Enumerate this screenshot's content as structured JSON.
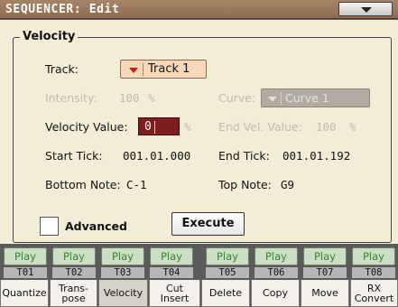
{
  "header": {
    "title": "SEQUENCER: Edit",
    "menu_icon": "chevron-down-icon"
  },
  "panel": {
    "section_title": "Velocity",
    "track": {
      "label": "Track:",
      "value": "Track 1"
    },
    "intensity": {
      "label": "Intensity:",
      "value": "100",
      "unit": "%"
    },
    "curve": {
      "label": "Curve:",
      "value": "Curve 1"
    },
    "velocity_value": {
      "label": "Velocity Value:",
      "value": "0",
      "unit": "%"
    },
    "end_vel_value": {
      "label": "End Vel. Value:",
      "value": "100",
      "unit": "%"
    },
    "start_tick": {
      "label": "Start Tick:",
      "value": "001.01.000"
    },
    "end_tick": {
      "label": "End Tick:",
      "value": "001.01.192"
    },
    "bottom_note": {
      "label": "Bottom Note:",
      "value": "C-1"
    },
    "top_note": {
      "label": "Top Note:",
      "value": "G9"
    },
    "advanced": {
      "label": "Advanced",
      "checked": false
    },
    "execute_label": "Execute"
  },
  "tracks": [
    {
      "play": "Play",
      "num": "T01"
    },
    {
      "play": "Play",
      "num": "T02"
    },
    {
      "play": "Play",
      "num": "T03"
    },
    {
      "play": "Play",
      "num": "T04"
    },
    {
      "play": "Play",
      "num": "T05"
    },
    {
      "play": "Play",
      "num": "T06"
    },
    {
      "play": "Play",
      "num": "T07"
    },
    {
      "play": "Play",
      "num": "T08"
    }
  ],
  "tabs": [
    {
      "label": "Quantize"
    },
    {
      "label": "Trans-\npose"
    },
    {
      "label": "Velocity",
      "active": true
    },
    {
      "label": "Cut\nInsert"
    },
    {
      "label": "Delete"
    },
    {
      "label": "Copy"
    },
    {
      "label": "Move"
    },
    {
      "label": "RX\nConvert"
    }
  ],
  "colors": {
    "title_bar": "#9a7a5e",
    "panel": "#f3ecd6",
    "track_button": "#f7d8b8",
    "velocity_field": "#7e1d1d",
    "play_text": "#2f8b2f",
    "play_bg": "#ccdfc4"
  }
}
